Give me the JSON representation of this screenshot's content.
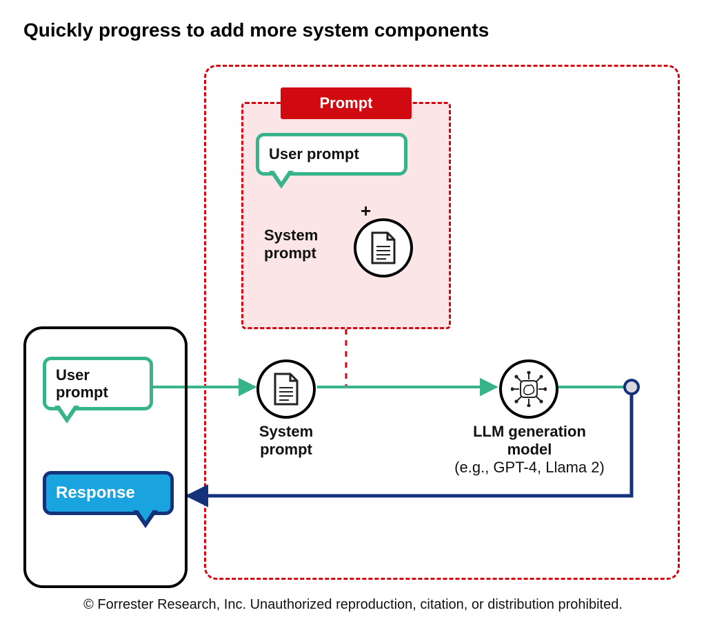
{
  "title": "Quickly progress to add more system components",
  "prompt_group": {
    "header": "Prompt",
    "user_prompt_label": "User prompt",
    "plus": "+",
    "system_prompt_label": "System\nprompt"
  },
  "phone": {
    "user_prompt_label": "User\nprompt",
    "response_label": "Response"
  },
  "flow": {
    "system_prompt_label": "System\nprompt",
    "llm_label_line1": "LLM generation",
    "llm_label_line2": "model",
    "llm_sub": "(e.g., GPT-4, Llama 2)"
  },
  "footer": "© Forrester Research, Inc. Unauthorized reproduction, citation, or distribution prohibited."
}
